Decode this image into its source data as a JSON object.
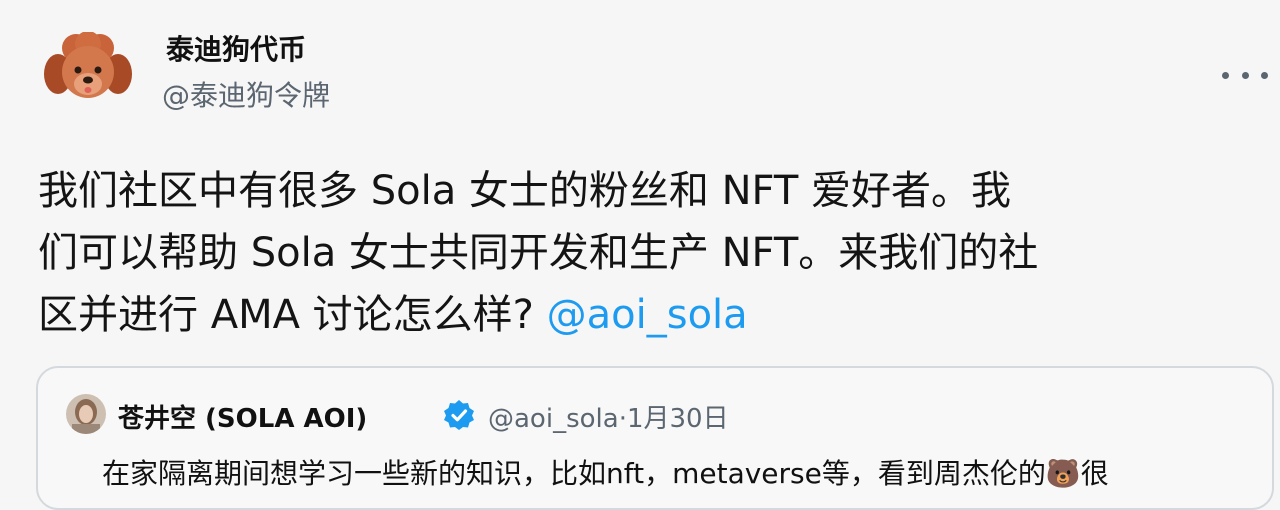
{
  "author": {
    "display_name": "泰迪狗代币",
    "handle": "@泰迪狗令牌"
  },
  "tweet": {
    "lines": [
      "我们社区中有很多 Sola 女士的粉丝和 NFT 爱好者。我",
      "们可以帮助 Sola 女士共同开发和生产 NFT。来我们的社",
      "区并进行 AMA 讨论怎么样? "
    ],
    "mention": "@aoi_sola"
  },
  "quoted_tweet": {
    "display_name": "苍井空 (SOLA AOI)",
    "handle": "@aoi_sola",
    "separator": "·",
    "date": "1月30日",
    "text": "在家隔离期间想学习一些新的知识，比如nft，metaverse等，看到周杰伦的🐻很"
  },
  "colors": {
    "accent": "#1d9bf0",
    "muted_text": "#5b6670",
    "background": "#f6f6f6"
  },
  "icons": {
    "more": "more-dots-icon",
    "verified": "verified-badge-icon"
  }
}
